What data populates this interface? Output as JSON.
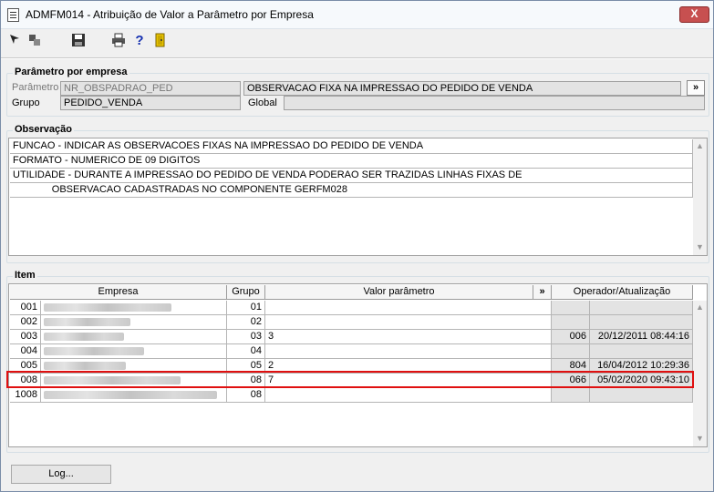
{
  "window": {
    "title": "ADMFM014 - Atribuição de Valor a Parâmetro por Empresa",
    "close_label": "X"
  },
  "toolbar": {
    "icons": [
      "arrow-select-icon",
      "window-tile-icon",
      "save-icon",
      "print-icon",
      "help-icon",
      "exit-door-icon"
    ],
    "help_glyph": "?"
  },
  "parametro": {
    "section_label": "Parâmetro por empresa",
    "param_label": "Parâmetro",
    "param_value": "NR_OBSPADRAO_PED",
    "param_desc": "OBSERVACAO FIXA NA IMPRESSAO DO PEDIDO DE VENDA",
    "more_label": "»",
    "grupo_label": "Grupo",
    "grupo_value": "PEDIDO_VENDA",
    "global_label": "Global",
    "global_value": ""
  },
  "observacao": {
    "section_label": "Observação",
    "lines": [
      "FUNCAO - INDICAR AS OBSERVACOES FIXAS NA IMPRESSAO DO PEDIDO DE VENDA",
      "FORMATO - NUMERICO DE 09 DIGITOS",
      "UTILIDADE - DURANTE A IMPRESSAO DO PEDIDO DE VENDA PODERAO SER TRAZIDAS LINHAS FIXAS DE",
      "              OBSERVACAO CADASTRADAS NO COMPONENTE GERFM028"
    ]
  },
  "item": {
    "section_label": "Item",
    "columns": {
      "empresa": "Empresa",
      "grupo": "Grupo",
      "valor": "Valor parâmetro",
      "more": "»",
      "operador": "Operador/Atualização"
    },
    "rows": [
      {
        "code": "001",
        "grupo": "01",
        "valor": "",
        "operador": "",
        "atualizacao": ""
      },
      {
        "code": "002",
        "grupo": "02",
        "valor": "",
        "operador": "",
        "atualizacao": ""
      },
      {
        "code": "003",
        "grupo": "03",
        "valor": "3",
        "operador": "006",
        "atualizacao": "20/12/2011 08:44:16"
      },
      {
        "code": "004",
        "grupo": "04",
        "valor": "",
        "operador": "",
        "atualizacao": ""
      },
      {
        "code": "005",
        "grupo": "05",
        "valor": "2",
        "operador": "804",
        "atualizacao": "16/04/2012 10:29:36"
      },
      {
        "code": "008",
        "grupo": "08",
        "valor": "7",
        "operador": "066",
        "atualizacao": "05/02/2020 09:43:10"
      },
      {
        "code": "1008",
        "grupo": "08",
        "valor": "",
        "operador": "",
        "atualizacao": ""
      }
    ]
  },
  "footer": {
    "log_label": "Log..."
  },
  "colors": {
    "highlight": "#e01010",
    "window_border": "#7a8da8",
    "close_button": "#c75050"
  }
}
